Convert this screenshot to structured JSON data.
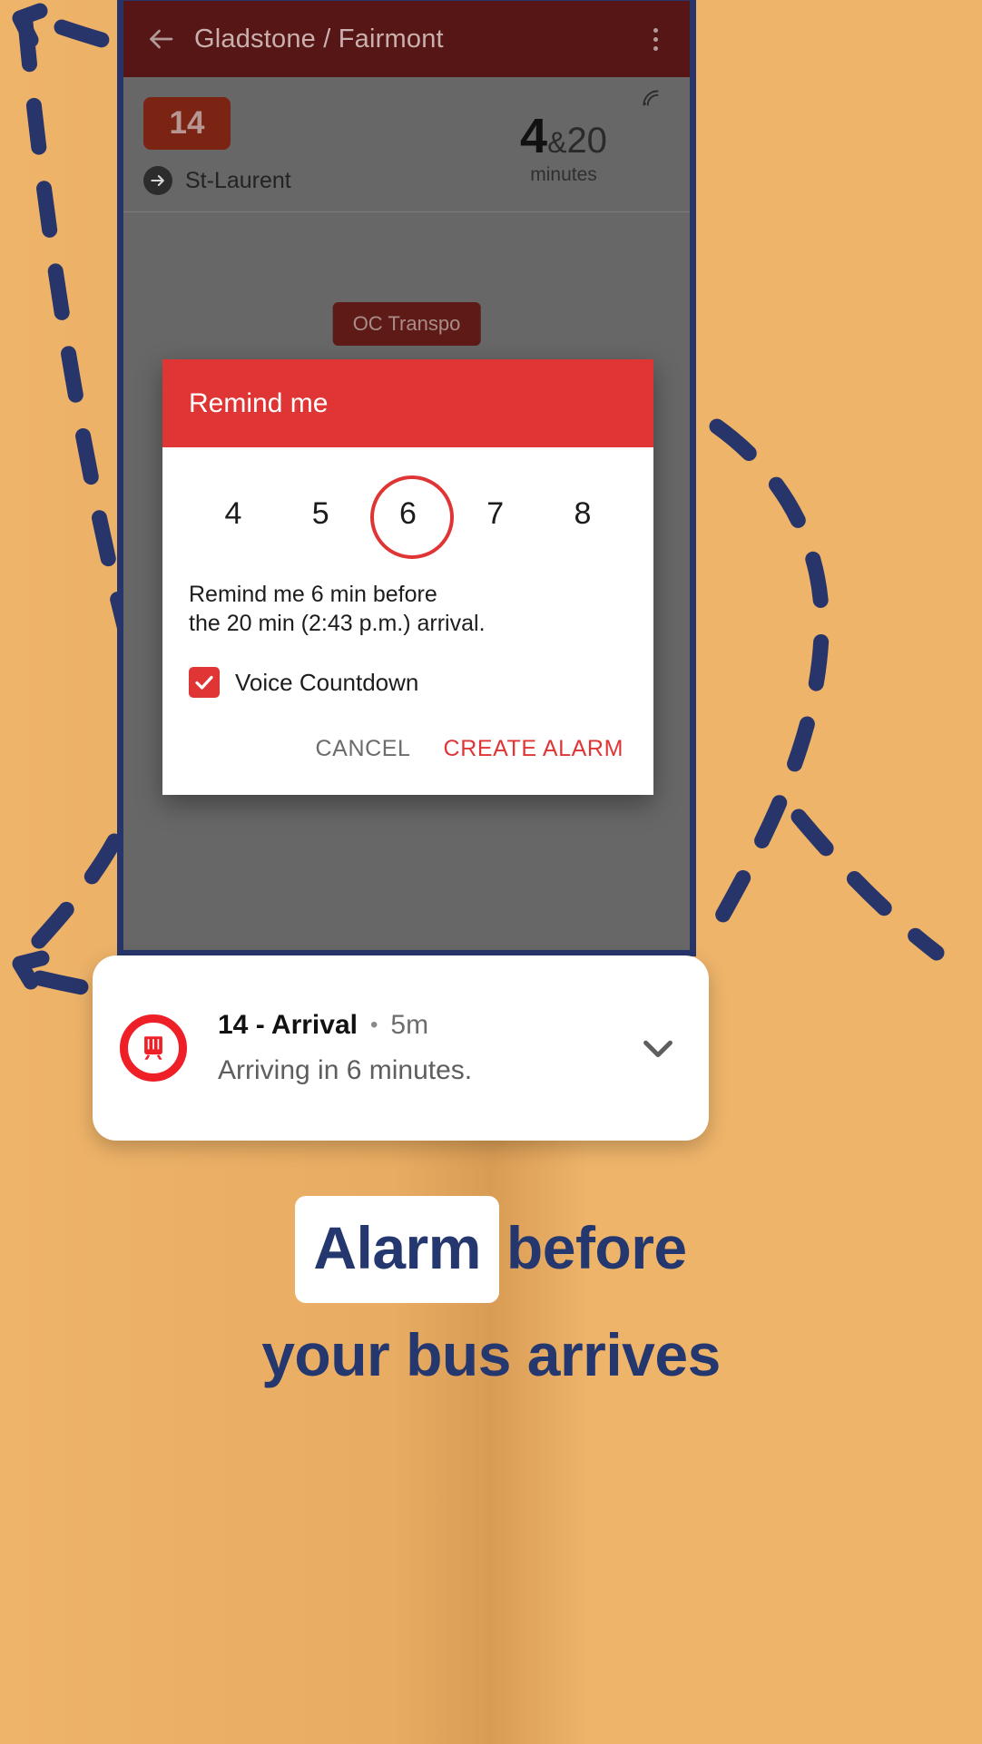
{
  "theme": {
    "background": "#eeb46a",
    "frame_blue": "#27356b",
    "accent_red": "#e03535",
    "appbar_maroon": "#551615",
    "route_badge": "#7c2414",
    "headline_navy": "#25376f",
    "notif_red": "#ef1f28"
  },
  "app": {
    "appbar": {
      "back_icon": "arrow-left-icon",
      "title": "Gladstone / Fairmont",
      "overflow_icon": "kebab-menu-icon"
    },
    "stop": {
      "route_number": "14",
      "direction_icon": "arrow-right-circle-icon",
      "destination": "St-Laurent",
      "live_icon": "live-signal-icon",
      "next_time": "4",
      "separator": "&",
      "following_time": "20",
      "unit_label": "minutes"
    },
    "toast": {
      "label": "OC Transpo"
    },
    "dialog": {
      "title": "Remind me",
      "picker_values": [
        "4",
        "5",
        "6",
        "7",
        "8"
      ],
      "picker_selected": "6",
      "summary_line1": "Remind me 6 min before",
      "summary_line2": "the 20 min (2:43 p.m.) arrival.",
      "checkbox": {
        "checked": true,
        "label": "Voice Countdown",
        "icon": "checkmark-icon"
      },
      "cancel_label": "CANCEL",
      "create_label": "CREATE ALARM"
    }
  },
  "notification": {
    "icon": "bus-circle-icon",
    "title": "14 - Arrival",
    "separator": "•",
    "time_ago": "5m",
    "body": "Arriving in 6 minutes.",
    "expand_icon": "chevron-down-icon"
  },
  "promo": {
    "headline_highlight": "Alarm",
    "headline_rest": "before",
    "headline_line2": "your bus arrives"
  }
}
